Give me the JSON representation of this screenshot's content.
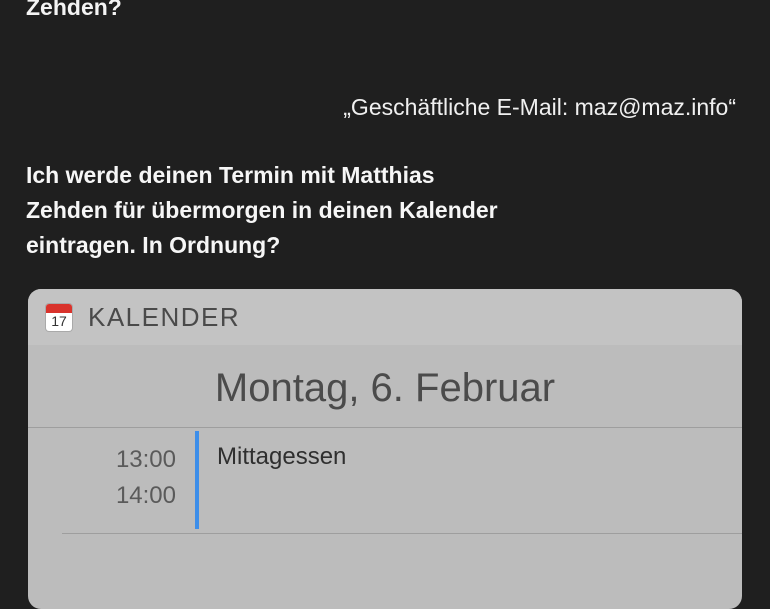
{
  "conversation": {
    "previous_siri_text": "Zehden?",
    "user_quote": "„Geschäftliche E-Mail: maz@maz.info“",
    "siri_reply_lines": [
      "Ich werde deinen Termin mit Matthias",
      "Zehden für übermorgen in deinen Kalender",
      "eintragen. In Ordnung?"
    ]
  },
  "calendar_card": {
    "icon": "calendar-icon",
    "icon_day": "17",
    "title": "KALENDER",
    "date": "Montag, 6. Februar",
    "event": {
      "start": "13:00",
      "end": "14:00",
      "name": "Mittagessen"
    },
    "colors": {
      "event_bar": "#3d8ee9",
      "icon_header": "#d9332c"
    }
  }
}
